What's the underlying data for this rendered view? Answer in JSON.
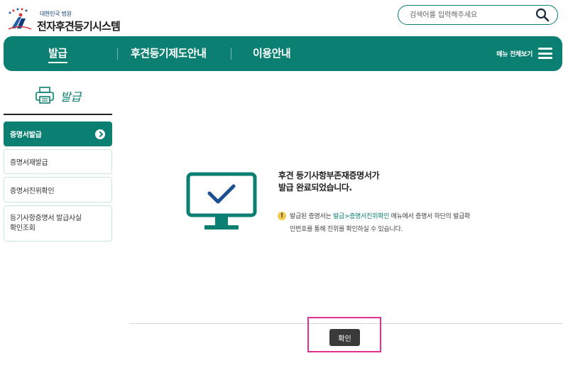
{
  "header": {
    "logo_sub": "대한민국 법원",
    "logo_title": "전자후견등기시스템"
  },
  "search": {
    "placeholder": "검색어를 입력해주세요",
    "icon": "search-icon"
  },
  "nav": {
    "items": [
      {
        "label": "발급",
        "active": true
      },
      {
        "label": "후견등기제도안내",
        "active": false
      },
      {
        "label": "이용안내",
        "active": false
      }
    ],
    "all_menu_label": "메뉴 전체보기",
    "accent": "#0b7f71"
  },
  "sidebar": {
    "title": "발급",
    "title_icon": "printer-icon",
    "items": [
      {
        "label": "증명서발급",
        "active": true
      },
      {
        "label": "증명서재발급",
        "active": false
      },
      {
        "label": "증명서진위확인",
        "active": false
      },
      {
        "label": "등기사항증명서 발급사실\n확인조회",
        "active": false
      }
    ]
  },
  "result": {
    "icon": "monitor-check-icon",
    "title_line1": "후견 등기사항부존재증명서가",
    "title_line2": "발급 완료되었습니다.",
    "notice_prefix": "발급된 증명서는 ",
    "notice_link": "발급>증명서진위확인",
    "notice_suffix": " 메뉴에서 증명서 하단의 발급확",
    "notice_line2": "인번호를 통해 진위를 확인하실 수 있습니다.",
    "notice_icon": "!"
  },
  "actions": {
    "confirm_label": "확인",
    "highlight_color": "#e0318f"
  }
}
